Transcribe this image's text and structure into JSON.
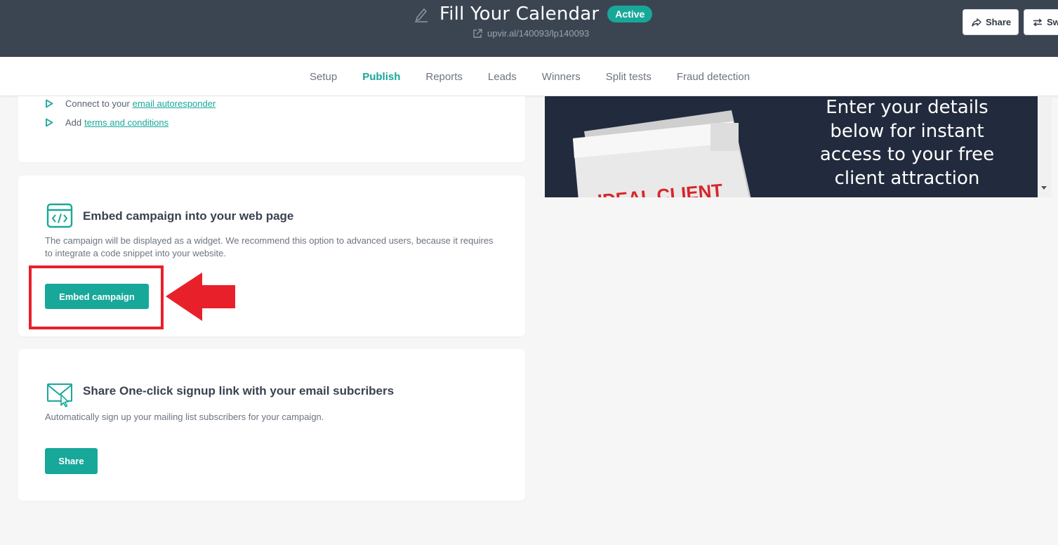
{
  "header": {
    "title": "Fill Your Calendar",
    "status": "Active",
    "url": "upvir.al/140093/lp140093",
    "share_label": "Share",
    "switch_label": "Sw"
  },
  "tabs": [
    "Setup",
    "Publish",
    "Reports",
    "Leads",
    "Winners",
    "Split tests",
    "Fraud detection"
  ],
  "active_tab": "Publish",
  "checklist": [
    {
      "prefix": "Connect to your",
      "link": "email autoresponder"
    },
    {
      "prefix": "Add",
      "link": "terms and conditions"
    }
  ],
  "embed_card": {
    "icon": "code-window-icon",
    "title": "Embed campaign into your web page",
    "description": "The campaign will be displayed as a widget. We recommend this option to advanced users, because it requires to integrate a code snippet into your website.",
    "button_label": "Embed campaign"
  },
  "share_card": {
    "icon": "envelope-cursor-icon",
    "title": "Share One-click signup link with your email subcribers",
    "description": "Automatically sign up your mailing list subscribers for your campaign.",
    "button_label": "Share"
  },
  "preview": {
    "text": "Enter your details below for instant access to your free client attraction",
    "book_text": "IDEAL CLIENT"
  },
  "colors": {
    "accent": "#17a89a",
    "header_bg": "#3b4552",
    "annotation": "#e8202a",
    "preview_bg": "#222a3d"
  }
}
